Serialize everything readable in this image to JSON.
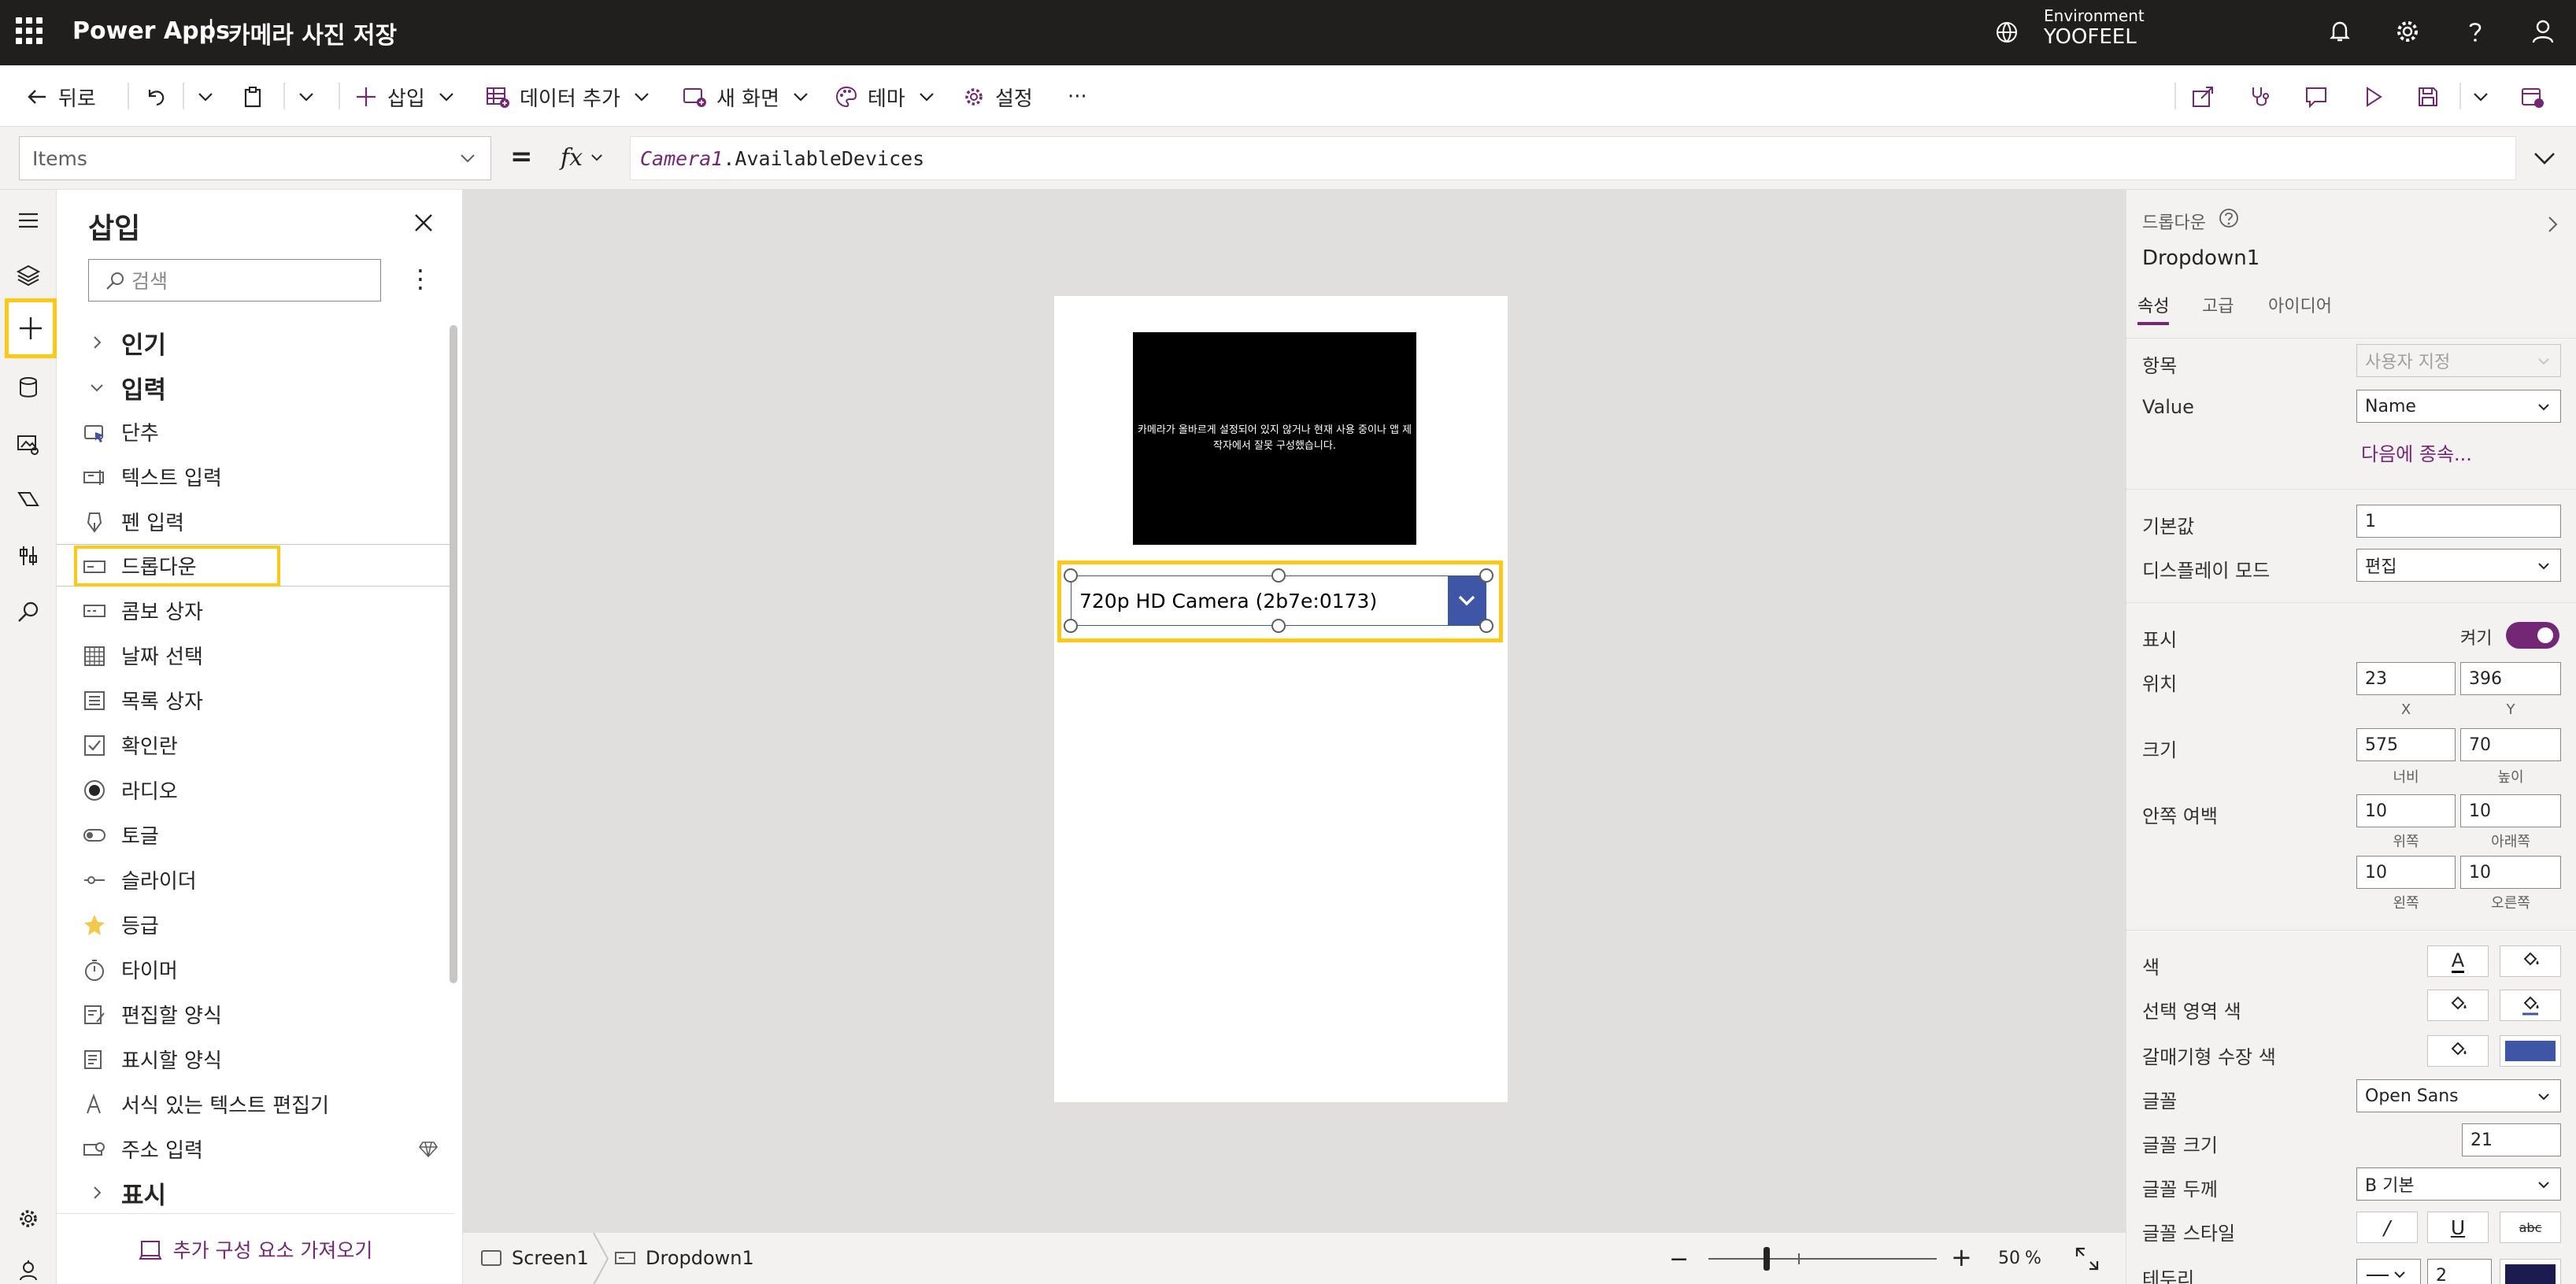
{
  "header": {
    "app_name": "Power Apps",
    "separator": "|",
    "document_title": "카메라 사진 저장",
    "environment_label": "Environment",
    "environment_name": "YOOFEEL"
  },
  "command_bar": {
    "back": "뒤로",
    "insert": "삽입",
    "add_data": "데이터 추가",
    "new_screen": "새 화면",
    "theme": "테마",
    "settings": "설정",
    "more": "···"
  },
  "formula_bar": {
    "property": "Items",
    "equals": "=",
    "fx": "fx",
    "formula_object": "Camera1",
    "formula_member": ".AvailableDevices"
  },
  "insert_pane": {
    "title": "삽입",
    "search_placeholder": "검색",
    "more": "⋮",
    "groups": {
      "popular": "인기",
      "input": "입력",
      "display": "표시"
    },
    "items": [
      {
        "label": "단추",
        "icon": "button-icon"
      },
      {
        "label": "텍스트 입력",
        "icon": "text-input-icon"
      },
      {
        "label": "펜 입력",
        "icon": "pen-icon"
      },
      {
        "label": "드롭다운",
        "icon": "dropdown-icon"
      },
      {
        "label": "콤보 상자",
        "icon": "combobox-icon"
      },
      {
        "label": "날짜 선택",
        "icon": "calendar-icon"
      },
      {
        "label": "목록 상자",
        "icon": "listbox-icon"
      },
      {
        "label": "확인란",
        "icon": "checkbox-icon"
      },
      {
        "label": "라디오",
        "icon": "radio-icon"
      },
      {
        "label": "토글",
        "icon": "toggle-icon"
      },
      {
        "label": "슬라이더",
        "icon": "slider-icon"
      },
      {
        "label": "등급",
        "icon": "star-icon"
      },
      {
        "label": "타이머",
        "icon": "timer-icon"
      },
      {
        "label": "편집할 양식",
        "icon": "edit-form-icon"
      },
      {
        "label": "표시할 양식",
        "icon": "display-form-icon"
      },
      {
        "label": "서식 있는 텍스트 편집기",
        "icon": "rich-text-icon"
      },
      {
        "label": "주소 입력",
        "icon": "address-input-icon"
      }
    ],
    "footer": "추가 구성 요소 가져오기"
  },
  "canvas": {
    "camera_message": "카메라가 올바르게 설정되어 있지 않거나 현재 사용 중이나 앱 제작자에서 잘못 구성했습니다.",
    "dropdown_value": "720p HD Camera (2b7e:0173)"
  },
  "status_bar": {
    "screen": "Screen1",
    "control": "Dropdown1",
    "zoom_minus": "−",
    "zoom_plus": "+",
    "zoom_value": "50",
    "zoom_unit": "%",
    "zoom_level": 0.5
  },
  "properties": {
    "control_type": "드롭다운",
    "control_name": "Dropdown1",
    "tabs": [
      "속성",
      "고급",
      "아이디어"
    ],
    "items_label": "항목",
    "items_value": "사용자 지정",
    "value_label": "Value",
    "value_value": "Name",
    "depends_link": "다음에 종속...",
    "default_label": "기본값",
    "default_value": "1",
    "display_mode_label": "디스플레이 모드",
    "display_mode_value": "편집",
    "visible_label": "표시",
    "visible_state": "켜기",
    "position_label": "위치",
    "x_value": "23",
    "y_value": "396",
    "x_caption": "X",
    "y_caption": "Y",
    "size_label": "크기",
    "width_value": "575",
    "height_value": "70",
    "width_caption": "너비",
    "height_caption": "높이",
    "padding_label": "안쪽 여백",
    "pad_top": "10",
    "pad_bottom": "10",
    "pad_left": "10",
    "pad_right": "10",
    "pad_top_caption": "위쪽",
    "pad_bottom_caption": "아래쪽",
    "pad_left_caption": "왼쪽",
    "pad_right_caption": "오른쪽",
    "color_label": "색",
    "selection_color_label": "선택 영역 색",
    "chevron_color_label": "갈매기형 수장 색",
    "font_label": "글꼴",
    "font_value": "Open Sans",
    "font_size_label": "글꼴 크기",
    "font_size_value": "21",
    "font_weight_label": "글꼴 두께",
    "font_weight_value": "B  기본",
    "font_style_label": "글꼴 스타일",
    "border_label": "테두리",
    "border_value": "2",
    "text_glyph": "A",
    "italic_glyph": "/",
    "underline_glyph": "U",
    "strike_glyph": "abc"
  },
  "colors": {
    "accent": "#742774",
    "selection": "#ffc814",
    "dropdown_chevron_fill": "#3f55a5",
    "border_swatch": "#1c1b4f"
  }
}
